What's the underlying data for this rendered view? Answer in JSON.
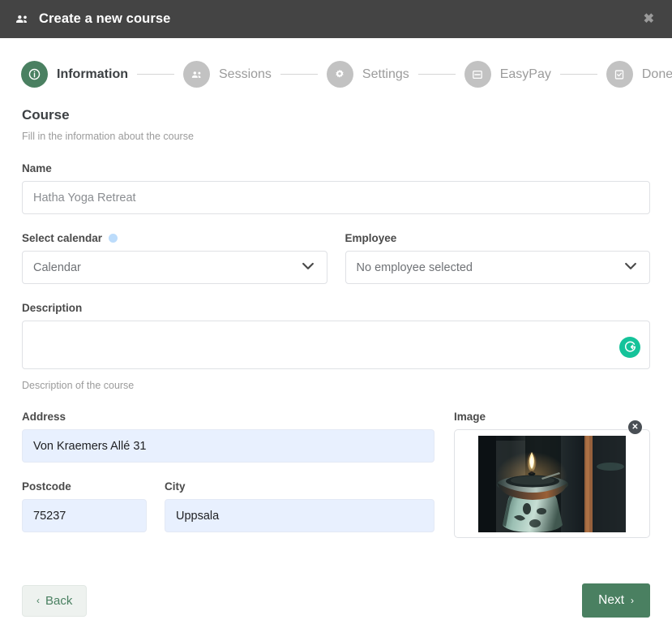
{
  "header": {
    "icon": "users-group-icon",
    "title": "Create a new course",
    "close_label": "✖"
  },
  "stepper": {
    "steps": [
      {
        "label": "Information",
        "icon": "info-circle-icon",
        "active": true
      },
      {
        "label": "Sessions",
        "icon": "users-group-icon",
        "active": false
      },
      {
        "label": "Settings",
        "icon": "gear-icon",
        "active": false
      },
      {
        "label": "EasyPay",
        "icon": "credit-card-icon",
        "active": false
      },
      {
        "label": "Done",
        "icon": "clipboard-check-icon",
        "active": false
      }
    ]
  },
  "section": {
    "title": "Course",
    "subtitle": "Fill in the information about the course"
  },
  "fields": {
    "name": {
      "label": "Name",
      "value": "",
      "placeholder": "Hatha Yoga Retreat"
    },
    "calendar": {
      "label": "Select calendar",
      "value": "Calendar",
      "dot_color": "#bcdcfb"
    },
    "employee": {
      "label": "Employee",
      "value": "No employee selected"
    },
    "description": {
      "label": "Description",
      "value": "",
      "placeholder": "",
      "help": "Description of the course",
      "assistant_icon": "grammarly-icon"
    },
    "address": {
      "label": "Address",
      "value": "Von Kraemers Allé 31"
    },
    "postcode": {
      "label": "Postcode",
      "value": "75237"
    },
    "city": {
      "label": "City",
      "value": "Uppsala"
    },
    "image": {
      "label": "Image",
      "remove_label": "✕",
      "alt": "Lit candle on a ceramic oil burner in a dark room"
    }
  },
  "footer": {
    "back_label": "Back",
    "back_chevron": "‹",
    "next_label": "Next",
    "next_chevron": "›"
  },
  "colors": {
    "accent_green": "#4a8061",
    "header_bg": "#444444",
    "autofill_bg": "#e8f0fe",
    "grammarly_green": "#15c39a",
    "step_inactive": "#c2c2c2"
  }
}
